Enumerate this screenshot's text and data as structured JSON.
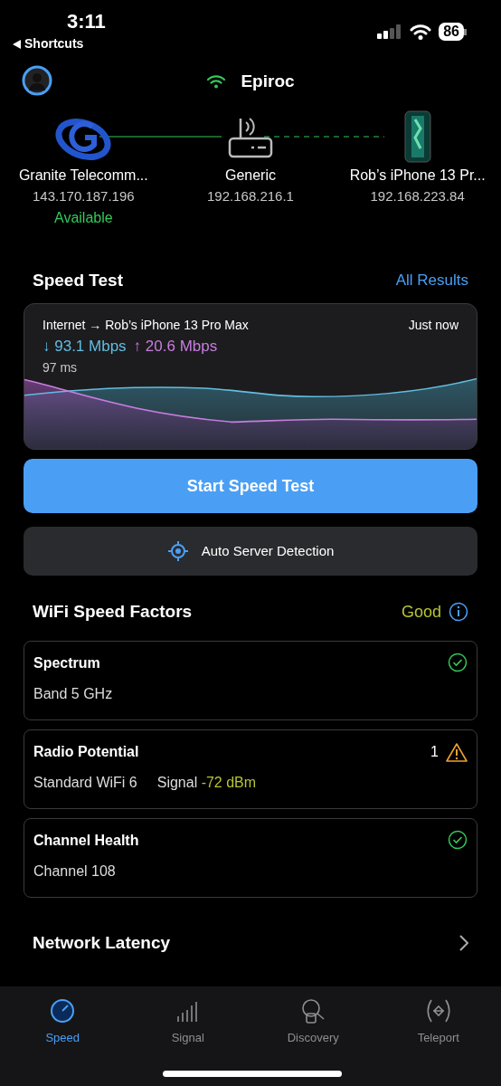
{
  "status_bar": {
    "time": "3:11",
    "back_label": "Shortcuts",
    "battery": "86"
  },
  "header": {
    "network": "Epiroc"
  },
  "topology": {
    "nodes": [
      {
        "kind": "isp",
        "name": "Granite Telecomm...",
        "ip": "143.170.187.196",
        "status": "Available"
      },
      {
        "kind": "router",
        "name": "Generic",
        "ip": "192.168.216.1"
      },
      {
        "kind": "phone",
        "name": "Rob’s iPhone 13 Pr...",
        "ip": "192.168.223.84"
      }
    ]
  },
  "speed_test": {
    "title": "Speed Test",
    "link": "All Results",
    "route": "Internet → Rob’s iPhone 13 Pro Max",
    "time": "Just now",
    "download": "↓ 93.1 Mbps",
    "upload": "↑ 20.6 Mbps",
    "latency": "97 ms",
    "start_button": "Start Speed Test",
    "server_button": "Auto Server Detection"
  },
  "factors": {
    "title": "WiFi Speed Factors",
    "rating": "Good",
    "items": [
      {
        "title": "Spectrum",
        "kind": "ok",
        "details": [
          {
            "text": "Band 5 GHz"
          }
        ]
      },
      {
        "title": "Radio Potential",
        "kind": "warning",
        "count": "1",
        "details": [
          {
            "text": "Standard WiFi 6"
          },
          {
            "text": "Signal",
            "value": "-72 dBm"
          }
        ]
      },
      {
        "title": "Channel Health",
        "kind": "ok",
        "details": [
          {
            "text": "Channel 108"
          }
        ]
      }
    ]
  },
  "latency_row": {
    "title": "Network Latency"
  },
  "tabs": [
    {
      "label": "Speed",
      "selected": true
    },
    {
      "label": "Signal",
      "selected": false
    },
    {
      "label": "Discovery",
      "selected": false
    },
    {
      "label": "Teleport",
      "selected": false
    }
  ]
}
